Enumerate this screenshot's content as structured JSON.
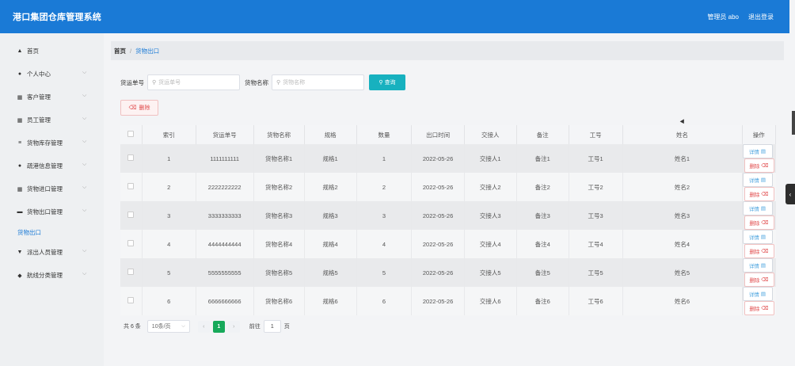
{
  "app": {
    "title": "港口集团仓库管理系统",
    "user": "管理员 abo",
    "logout": "退出登录"
  },
  "sidebar": {
    "items": [
      {
        "label": "首页",
        "icon": "home-icon",
        "glyph": "▲",
        "expandable": false
      },
      {
        "label": "个人中心",
        "icon": "user-icon",
        "glyph": "●",
        "expandable": true
      },
      {
        "label": "客户管理",
        "icon": "grid-icon",
        "glyph": "▦",
        "expandable": true
      },
      {
        "label": "员工管理",
        "icon": "grid-icon",
        "glyph": "▦",
        "expandable": true
      },
      {
        "label": "货物库存管理",
        "icon": "list-icon",
        "glyph": "≡",
        "expandable": true
      },
      {
        "label": "疏港信息管理",
        "icon": "person-icon",
        "glyph": "●",
        "expandable": true
      },
      {
        "label": "货物进口管理",
        "icon": "grid-icon",
        "glyph": "▦",
        "expandable": true
      },
      {
        "label": "货物出口管理",
        "icon": "box-icon",
        "glyph": "▬",
        "expandable": true
      }
    ],
    "active_sub": "货物出口",
    "items_after": [
      {
        "label": "派出人员管理",
        "icon": "flag-icon",
        "glyph": "▼",
        "expandable": true
      },
      {
        "label": "航线分类管理",
        "icon": "location-icon",
        "glyph": "◆",
        "expandable": true
      }
    ]
  },
  "breadcrumb": {
    "home": "首页",
    "sep": "/",
    "current": "货物出口"
  },
  "search": {
    "field1_label": "货运单号",
    "field1_placeholder": "货运单号",
    "field2_label": "货物名称",
    "field2_placeholder": "货物名称",
    "button": "查询"
  },
  "delete_button": "删除",
  "table": {
    "headers": [
      "索引",
      "货运单号",
      "货物名称",
      "规格",
      "数量",
      "出口时间",
      "交接人",
      "备注",
      "工号",
      "姓名",
      "操作"
    ],
    "rows": [
      [
        "1",
        "1111111111",
        "货物名称1",
        "规格1",
        "1",
        "2022-05-26",
        "交接人1",
        "备注1",
        "工号1",
        "姓名1"
      ],
      [
        "2",
        "2222222222",
        "货物名称2",
        "规格2",
        "2",
        "2022-05-26",
        "交接人2",
        "备注2",
        "工号2",
        "姓名2"
      ],
      [
        "3",
        "3333333333",
        "货物名称3",
        "规格3",
        "3",
        "2022-05-26",
        "交接人3",
        "备注3",
        "工号3",
        "姓名3"
      ],
      [
        "4",
        "4444444444",
        "货物名称4",
        "规格4",
        "4",
        "2022-05-26",
        "交接人4",
        "备注4",
        "工号4",
        "姓名4"
      ],
      [
        "5",
        "5555555555",
        "货物名称5",
        "规格5",
        "5",
        "2022-05-26",
        "交接人5",
        "备注5",
        "工号5",
        "姓名5"
      ],
      [
        "6",
        "6666666666",
        "货物名称6",
        "规格6",
        "6",
        "2022-05-26",
        "交接人6",
        "备注6",
        "工号6",
        "姓名6"
      ]
    ],
    "detail_label": "详情",
    "remove_label": "删除"
  },
  "pagination": {
    "total": "共 6 条",
    "page_size": "10条/页",
    "current": "1",
    "goto_label": "前往",
    "goto_value": "1",
    "page_suffix": "页"
  },
  "colors": {
    "primary": "#1a7ad6",
    "accent": "#17b1bf",
    "danger": "#e0494a",
    "pager_active": "#17a95a"
  }
}
